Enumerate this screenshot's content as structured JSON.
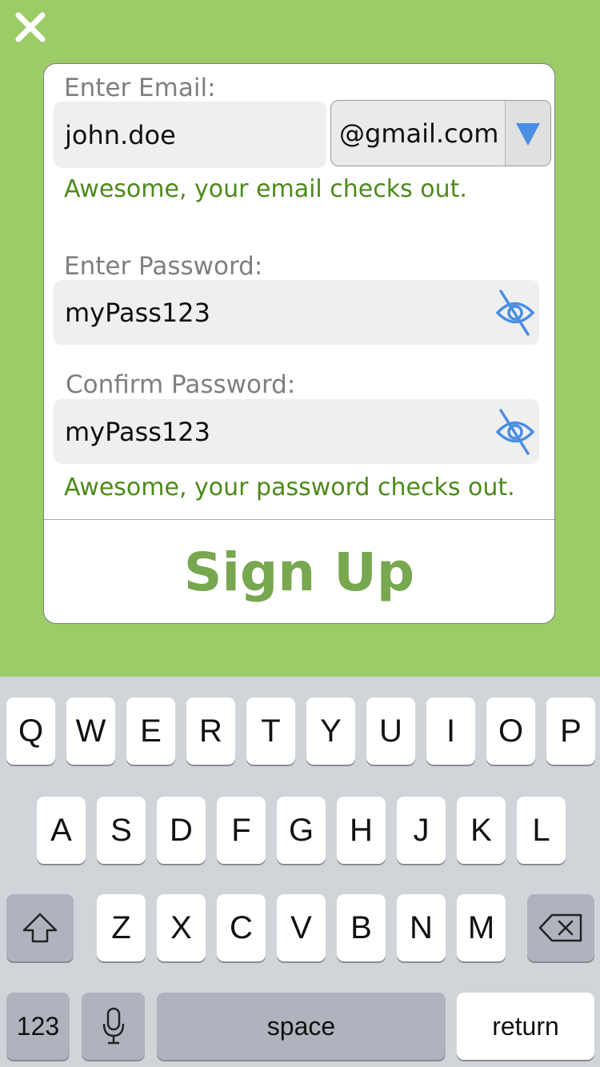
{
  "email": {
    "label": "Enter Email:",
    "value": "john.doe",
    "domain": "@gmail.com",
    "status": "Awesome, your email checks out."
  },
  "password": {
    "label": "Enter Password:",
    "value": "myPass123"
  },
  "confirm": {
    "label": "Confirm Password:",
    "value": "myPass123",
    "status": "Awesome, your password checks out."
  },
  "signup_label": "Sign Up",
  "icons": {
    "close": "close-icon",
    "dropdown": "triangle-down-icon",
    "password_visibility": "eye-slash-icon",
    "shift": "shift-arrow-icon",
    "mic": "microphone-icon",
    "backspace": "backspace-icon"
  },
  "colors": {
    "background": "#9bcc68",
    "accent_blue": "#4a8ee3",
    "success_text": "#4c8a1a",
    "signup_text": "#77a74e"
  },
  "keyboard": {
    "row1": [
      "Q",
      "W",
      "E",
      "R",
      "T",
      "Y",
      "U",
      "I",
      "O",
      "P"
    ],
    "row2": [
      "A",
      "S",
      "D",
      "F",
      "G",
      "H",
      "J",
      "K",
      "L"
    ],
    "row3": [
      "Z",
      "X",
      "C",
      "V",
      "B",
      "N",
      "M"
    ],
    "numbers_label": "123",
    "space_label": "space",
    "return_label": "return"
  }
}
